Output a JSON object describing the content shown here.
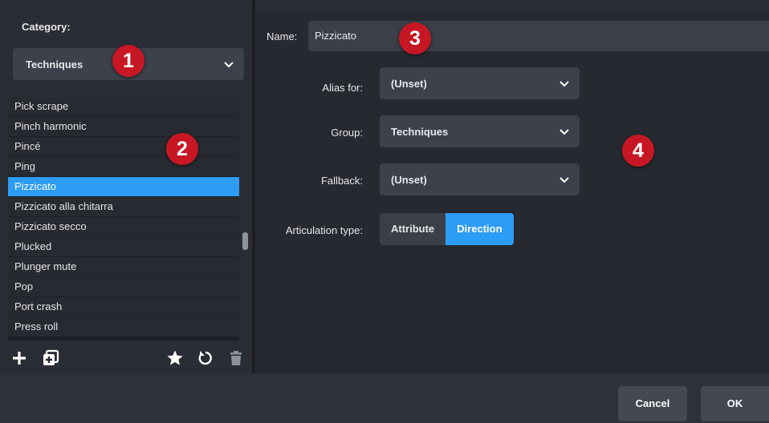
{
  "left_panel": {
    "category_label": "Category:",
    "category_value": "Techniques",
    "items": [
      {
        "label": "Pick scrape"
      },
      {
        "label": "Pinch harmonic"
      },
      {
        "label": "Pincé"
      },
      {
        "label": "Ping"
      },
      {
        "label": "Pizzicato",
        "selected": true
      },
      {
        "label": "Pizzicato alla chitarra"
      },
      {
        "label": "Pizzicato secco"
      },
      {
        "label": "Plucked"
      },
      {
        "label": "Plunger mute"
      },
      {
        "label": "Pop"
      },
      {
        "label": "Port crash"
      },
      {
        "label": "Press roll"
      }
    ],
    "toolbar_icons": [
      "plus-icon",
      "duplicate-icon",
      "star-icon",
      "reset-icon",
      "trash-icon"
    ]
  },
  "editor": {
    "name_label": "Name:",
    "name_value": "Pizzicato",
    "alias_label": "Alias for:",
    "alias_value": "(Unset)",
    "group_label": "Group:",
    "group_value": "Techniques",
    "fallback_label": "Fallback:",
    "fallback_value": "(Unset)",
    "articulation_label": "Articulation type:",
    "articulation_options": [
      "Attribute",
      "Direction"
    ],
    "articulation_selected": "Direction"
  },
  "footer": {
    "cancel_label": "Cancel",
    "ok_label": "OK"
  },
  "callouts": [
    "1",
    "2",
    "3",
    "4"
  ],
  "colors": {
    "accent": "#2d9cf5",
    "callout": "#c81724",
    "panel": "#262930"
  }
}
